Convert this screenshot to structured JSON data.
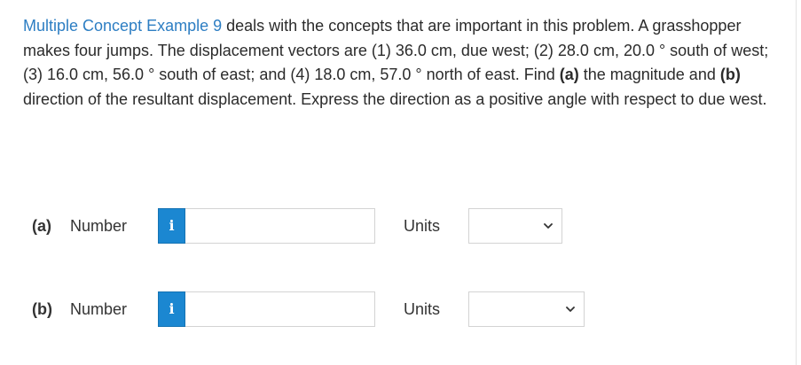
{
  "problem": {
    "link_text": "Multiple Concept Example 9",
    "text": " deals with the concepts that are important in this problem. A grasshopper makes four jumps. The displacement vectors are (1) 36.0 cm, due west; (2) 28.0 cm, 20.0 ° south of west; (3) 16.0 cm, 56.0 ° south of east; and (4) 18.0 cm, 57.0 ° north of east. Find ",
    "part_a_ref": "(a)",
    "text_mid": " the magnitude and ",
    "part_b_ref": "(b)",
    "text_end": " direction of the resultant displacement. Express the direction as a positive angle with respect to due west."
  },
  "answers": [
    {
      "part_label": "(a)",
      "number_label": "Number",
      "info_icon": "i",
      "number_value": "",
      "units_label": "Units",
      "units_value": ""
    },
    {
      "part_label": "(b)",
      "number_label": "Number",
      "info_icon": "i",
      "number_value": "",
      "units_label": "Units",
      "units_value": ""
    }
  ],
  "colors": {
    "link": "#2d7ec3",
    "info_button": "#1b87d1"
  },
  "icons": {
    "info": "info-icon",
    "dropdown": "chevron-down-icon"
  }
}
